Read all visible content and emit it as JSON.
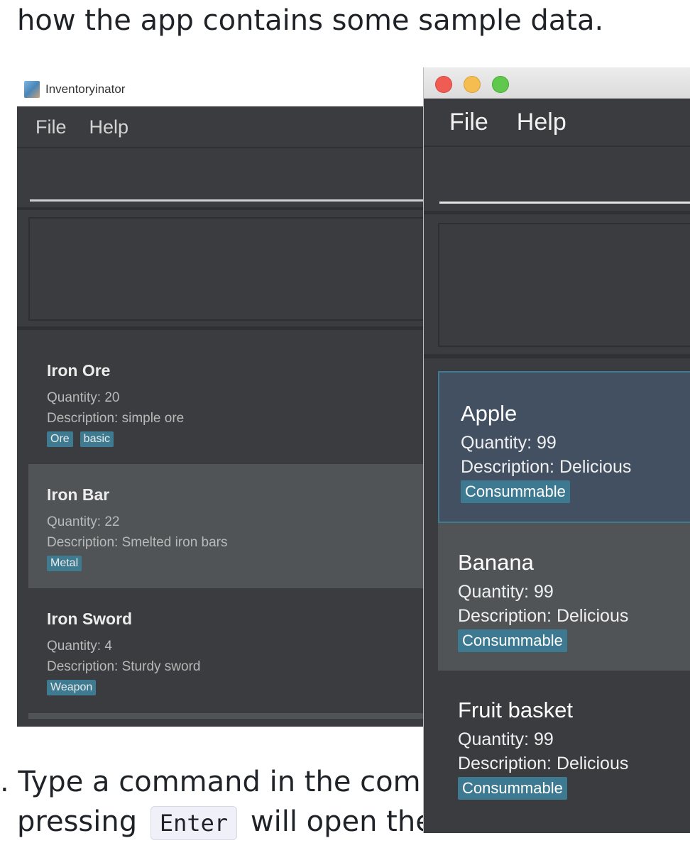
{
  "doc": {
    "top_text": "how the app contains some sample data.",
    "step_text": ". Type a command in the comm",
    "line3_before": "pressing",
    "line3_code": "Enter",
    "line3_after": "will open the"
  },
  "left_window": {
    "title": "Inventoryinator",
    "menu": [
      "File",
      "Help"
    ],
    "items": [
      {
        "name": "Iron Ore",
        "quantity": "Quantity: 20",
        "description": "Description: simple ore",
        "tags": [
          "Ore",
          "basic"
        ]
      },
      {
        "name": "Iron Bar",
        "quantity": "Quantity: 22",
        "description": "Description: Smelted iron bars",
        "tags": [
          "Metal"
        ]
      },
      {
        "name": "Iron Sword",
        "quantity": "Quantity: 4",
        "description": "Description: Sturdy sword",
        "tags": [
          "Weapon"
        ]
      }
    ]
  },
  "right_window": {
    "menu": [
      "File",
      "Help"
    ],
    "items": [
      {
        "name": "Apple",
        "quantity": "Quantity: 99",
        "description": "Description: Delicious",
        "tags": [
          "Consummable"
        ]
      },
      {
        "name": "Banana",
        "quantity": "Quantity: 99",
        "description": "Description: Delicious",
        "tags": [
          "Consummable"
        ]
      },
      {
        "name": "Fruit basket",
        "quantity": "Quantity: 99",
        "description": "Description: Delicious",
        "tags": [
          "Consummable"
        ]
      }
    ]
  },
  "colors": {
    "app_background": "#3b3c3f",
    "selected_card": "#425062",
    "alt_card": "#505457",
    "tag": "#3d7a91",
    "close": "#ee5c54",
    "minimize": "#f5bd4f",
    "zoom": "#5fc84d"
  }
}
